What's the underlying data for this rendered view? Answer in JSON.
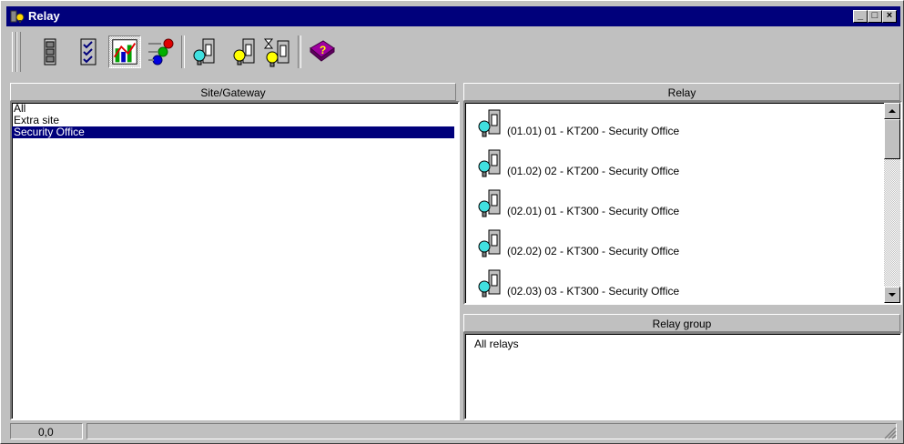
{
  "window": {
    "title": "Relay",
    "minimize": "_",
    "maximize": "□",
    "close": "×"
  },
  "toolbar": {
    "buttons": [
      {
        "icon": "relay-column-icon"
      },
      {
        "icon": "checklist-icon"
      },
      {
        "icon": "chart-icon"
      },
      {
        "icon": "traffic-lights-icon"
      },
      {
        "icon": "relay-bulb-icon"
      },
      {
        "icon": "relay-bulb-yellow-icon"
      },
      {
        "icon": "relay-timer-icon"
      },
      {
        "icon": "help-book-icon"
      }
    ]
  },
  "site_panel": {
    "header": "Site/Gateway",
    "items": [
      "All",
      "Extra site",
      "Security Office"
    ],
    "selected_index": 2
  },
  "relay_panel": {
    "header": "Relay",
    "items": [
      "(01.01) 01 - KT200 - Security Office",
      "(01.02) 02 - KT200 - Security Office",
      "(02.01) 01 - KT300 - Security Office",
      "(02.02) 02 - KT300 - Security Office",
      "(02.03) 03 - KT300 - Security Office"
    ]
  },
  "relay_group_panel": {
    "header": "Relay group",
    "items": [
      "All relays"
    ]
  },
  "statusbar": {
    "coords": "0,0",
    "message": ""
  }
}
